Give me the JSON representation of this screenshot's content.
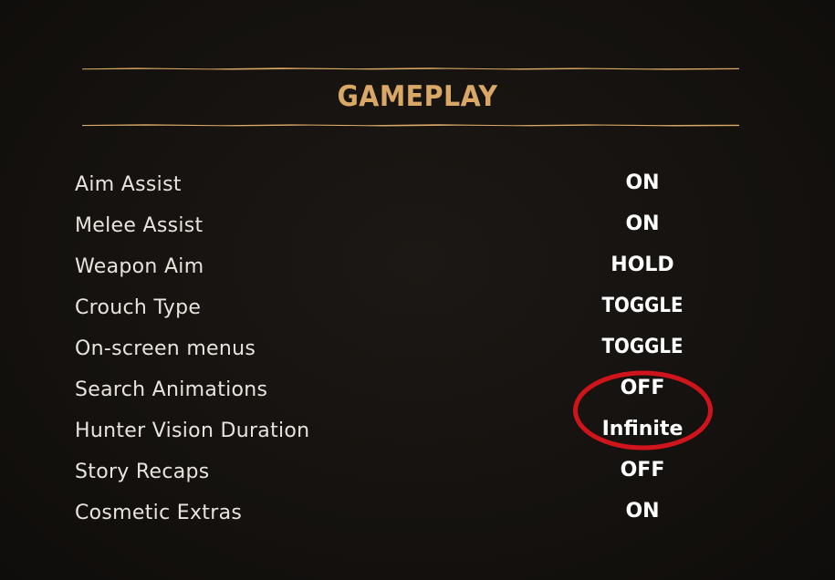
{
  "menu": {
    "title": "GAMEPLAY",
    "accent_color": "#d9a866",
    "settings": [
      {
        "label": "Aim Assist",
        "value": "ON"
      },
      {
        "label": "Melee Assist",
        "value": "ON"
      },
      {
        "label": "Weapon Aim",
        "value": "HOLD"
      },
      {
        "label": "Crouch Type",
        "value": "TOGGLE"
      },
      {
        "label": "On-screen menus",
        "value": "TOGGLE"
      },
      {
        "label": "Search Animations",
        "value": "OFF"
      },
      {
        "label": "Hunter Vision Duration",
        "value": "Infinite"
      },
      {
        "label": "Story Recaps",
        "value": "OFF"
      },
      {
        "label": "Cosmetic Extras",
        "value": "ON"
      }
    ]
  },
  "annotation": {
    "color": "#d0141c"
  }
}
